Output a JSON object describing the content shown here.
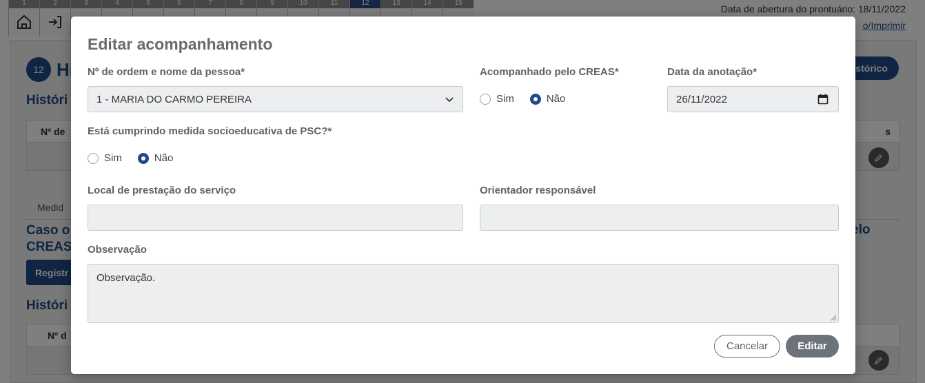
{
  "background": {
    "toolbar_numbers": [
      "1",
      "2",
      "3",
      "4",
      "5",
      "6",
      "7",
      "8",
      "9",
      "10",
      "11",
      "12",
      "13",
      "14",
      "15"
    ],
    "active_step": "12",
    "toolbar_icons": [
      "home-icon",
      "login-icon",
      "people-icon",
      "house-icon",
      "house-icon",
      "hands-icon",
      "heart-icon",
      "briefcase-icon",
      "handshake-icon",
      "person-icon",
      "hand-icon",
      "eye-icon",
      "group-icon",
      "card-icon",
      "house-icon",
      "phone-icon"
    ],
    "record_opening_date": "Data de abertura do prontuário: 18/11/2022",
    "print_link": "o/Imprimir",
    "step_badge": "12",
    "page_heading": "Hi",
    "history_pill": "stórico",
    "section_heading_1": "Históri",
    "table1_header_left": "Nº de",
    "table1_header_right": "s",
    "medida_label": "Medid",
    "caso_text_line1": "Caso o",
    "caso_text_line2": "CREAS.",
    "pelo_text": "elo",
    "register_button": "Registr",
    "section_heading_2": "Históri",
    "table2_header_left": "Nº d"
  },
  "modal": {
    "title": "Editar acompanhamento",
    "person_label": "Nº de ordem e nome da pessoa*",
    "person_value": "1 - MARIA DO CARMO PEREIRA",
    "creas_label": "Acompanhado pelo CREAS*",
    "creas_options": [
      "Sim",
      "Não"
    ],
    "creas_selected": "Não",
    "date_label": "Data da anotação*",
    "date_value": "26/11/2022",
    "psc_label": "Está cumprindo medida socioeducativa de PSC?*",
    "psc_options": [
      "Sim",
      "Não"
    ],
    "psc_selected": "Não",
    "local_label": "Local de prestação do serviço",
    "local_value": "",
    "orientador_label": "Orientador responsável",
    "orientador_value": "",
    "obs_label": "Observação",
    "obs_value": "Observação.",
    "cancel_button": "Cancelar",
    "edit_button": "Editar"
  }
}
